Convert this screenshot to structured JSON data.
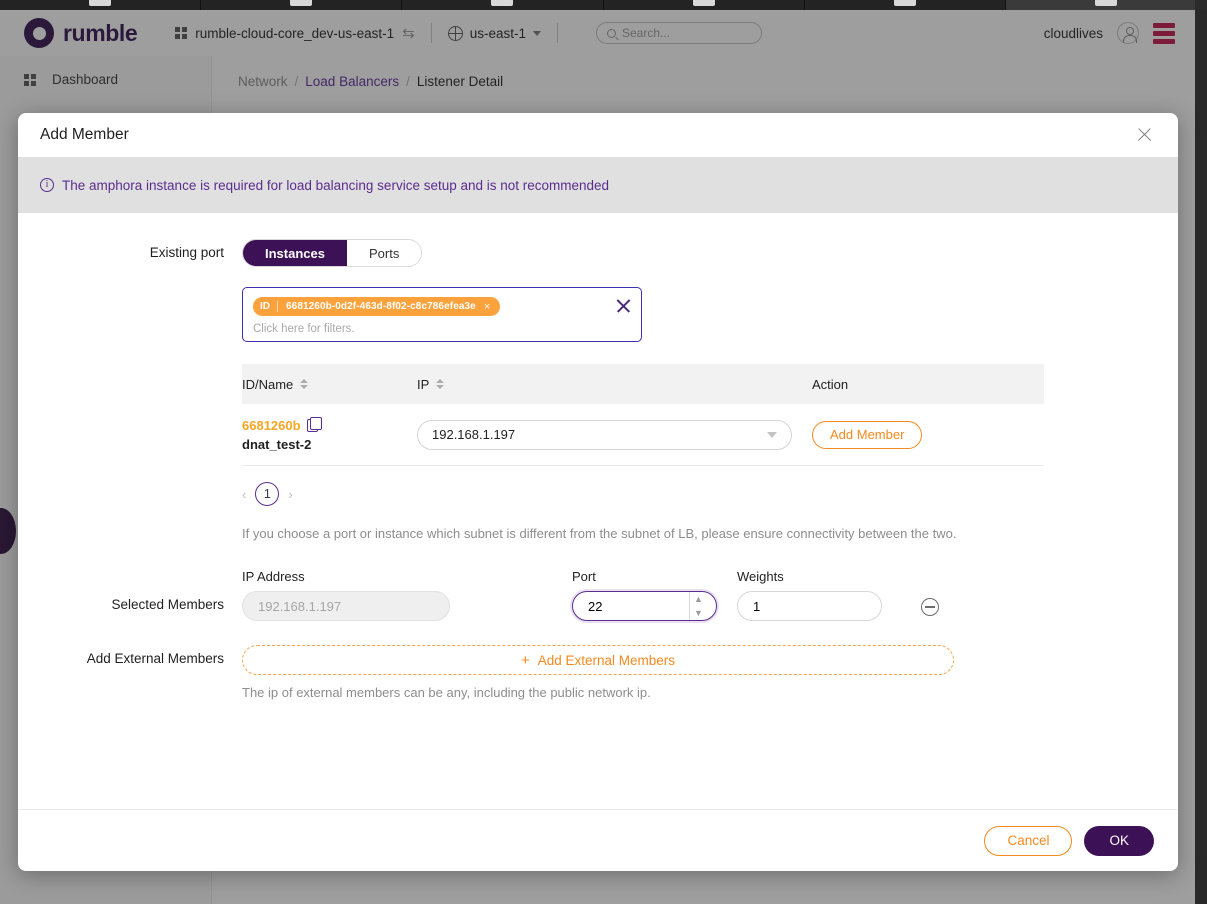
{
  "browser": {
    "tab_count": 6
  },
  "topbar": {
    "brand": "rumble",
    "project": "rumble-cloud-core_dev-us-east-1",
    "region": "us-east-1",
    "search_placeholder": "Search...",
    "user": "cloudlives"
  },
  "sidebar": {
    "items": [
      {
        "label": "Dashboard"
      }
    ]
  },
  "breadcrumb": {
    "items": [
      {
        "label": "Network",
        "type": "muted"
      },
      {
        "label": "Load Balancers",
        "type": "link"
      },
      {
        "label": "Listener Detail",
        "type": "current"
      }
    ],
    "separator": "/"
  },
  "modal": {
    "title": "Add Member",
    "close_label": "×",
    "banner": {
      "text": "The amphora instance is required for load balancing service setup and is not recommended",
      "icon": "i"
    },
    "existing_port": {
      "label": "Existing port",
      "tabs": [
        {
          "label": "Instances",
          "active": true
        },
        {
          "label": "Ports",
          "active": false
        }
      ],
      "filter": {
        "tag_key": "ID",
        "tag_value": "6681260b-0d2f-463d-8f02-c8c786efea3e",
        "tag_remove": "×",
        "placeholder": "Click here for filters."
      },
      "table": {
        "columns": [
          "ID/Name",
          "IP",
          "Action"
        ],
        "rows": [
          {
            "id": "6681260b",
            "name": "dnat_test-2",
            "ip": "192.168.1.197",
            "action_label": "Add Member"
          }
        ]
      },
      "pagination": {
        "prev": "‹",
        "page": "1",
        "next": "›"
      },
      "hint": "If you choose a port or instance which subnet is different from the subnet of LB, please ensure connectivity between the two."
    },
    "selected_members": {
      "label": "Selected Members",
      "columns": {
        "ip": "IP Address",
        "port": "Port",
        "weights": "Weights"
      },
      "rows": [
        {
          "ip_placeholder": "192.168.1.197",
          "port": "22",
          "weights": "1"
        }
      ]
    },
    "external_members": {
      "label": "Add External Members",
      "button_label": "Add External Members",
      "button_icon": "+",
      "hint": "The ip of external members can be any, including the public network ip."
    },
    "footer": {
      "cancel": "Cancel",
      "ok": "OK"
    }
  },
  "colors": {
    "brand_purple": "#3d1155",
    "accent_orange": "#f5891f",
    "tag_orange": "#fba23c",
    "banner_purple": "#5b2d8e",
    "menu_red": "#c2124a"
  }
}
